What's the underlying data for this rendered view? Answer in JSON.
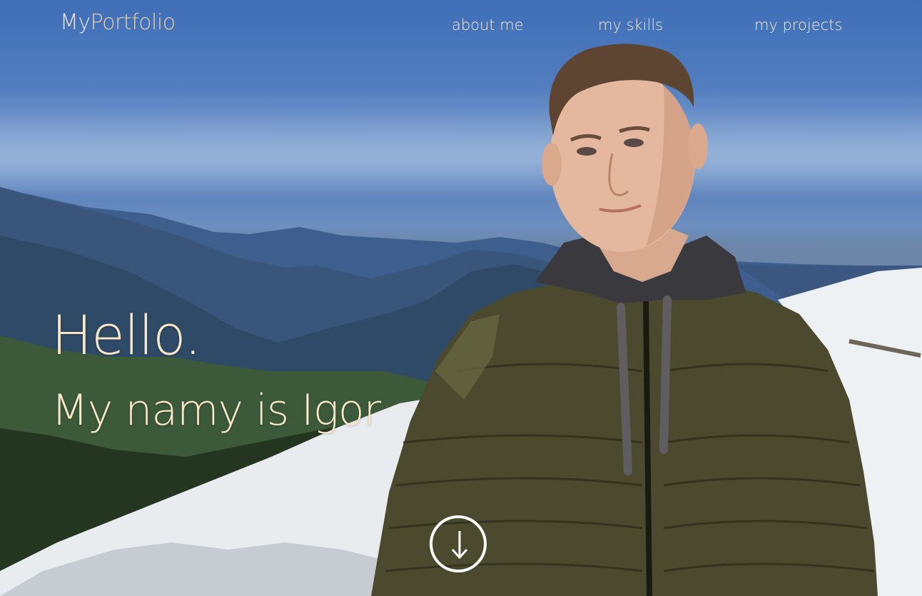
{
  "header": {
    "logo_my": "My",
    "logo_rest": "Portfolio",
    "nav": [
      {
        "label": "about me"
      },
      {
        "label": "my skills"
      },
      {
        "label": "my projects"
      }
    ]
  },
  "hero": {
    "greeting": "Hello.",
    "intro": "My namy is Igor",
    "scroll_icon": "arrow-down-icon",
    "background": "photo of a young man in an olive puffer jacket standing on a snowy mountain ridge with blue sky"
  },
  "colors": {
    "text_cream": "#f7e6c8",
    "logo_accent": "#e6cfa6",
    "sky": "#4f78b5",
    "jacket": "#4b4a2e",
    "snow": "#eef1f4"
  }
}
